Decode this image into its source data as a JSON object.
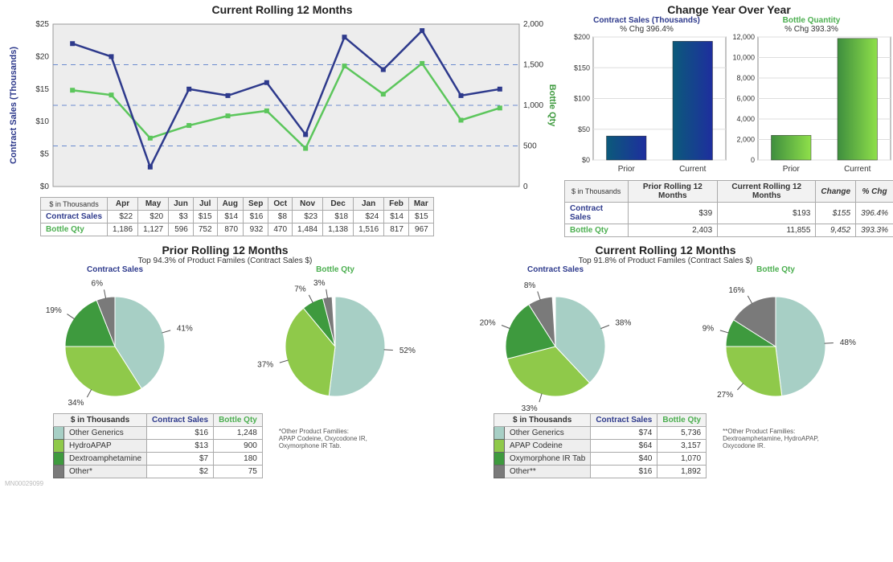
{
  "chart_data": [
    {
      "type": "line",
      "title": "Current Rolling 12 Months",
      "categories": [
        "Apr",
        "May",
        "Jun",
        "Jul",
        "Aug",
        "Sep",
        "Oct",
        "Nov",
        "Dec",
        "Jan",
        "Feb",
        "Mar"
      ],
      "series": [
        {
          "name": "Contract Sales (Thousands)",
          "values": [
            22,
            20,
            3,
            15,
            14,
            16,
            8,
            23,
            18,
            24,
            14,
            15
          ],
          "axis": "left",
          "color": "#2E3A8C"
        },
        {
          "name": "Bottle Qty",
          "values": [
            1186,
            1127,
            596,
            752,
            870,
            932,
            470,
            1484,
            1138,
            1516,
            817,
            967
          ],
          "axis": "right",
          "color": "#5CC65C"
        }
      ],
      "yleft": {
        "label": "Contract Sales (Thousands)",
        "ticks": [
          "$0",
          "$5",
          "$10",
          "$15",
          "$20",
          "$25"
        ],
        "lim": [
          0,
          25
        ]
      },
      "yright": {
        "label": "Bottle Qty",
        "ticks": [
          "0",
          "500",
          "1,000",
          "1,500",
          "2,000"
        ],
        "lim": [
          0,
          2000
        ]
      }
    },
    {
      "type": "bar",
      "title": "Contract Sales (Thousands)",
      "subtitle": "% Chg 396.4%",
      "categories": [
        "Prior",
        "Current"
      ],
      "values": [
        39,
        193
      ],
      "ylim": [
        0,
        200
      ],
      "yticks": [
        "$0",
        "$50",
        "$100",
        "$150",
        "$200"
      ],
      "color_from": "#0B5A7A",
      "color_to": "#1E2E9E"
    },
    {
      "type": "bar",
      "title": "Bottle Quantity",
      "subtitle": "% Chg 393.3%",
      "categories": [
        "Prior",
        "Current"
      ],
      "values": [
        2403,
        11855
      ],
      "ylim": [
        0,
        12000
      ],
      "yticks": [
        "0",
        "2,000",
        "4,000",
        "6,000",
        "8,000",
        "10,000",
        "12,000"
      ],
      "color_from": "#3E8E3E",
      "color_to": "#8FE04A"
    },
    {
      "type": "pie",
      "title": "Prior Rolling 12 Months – Contract Sales",
      "slices": [
        {
          "label": "Other Generics",
          "value": 41,
          "color": "#A7CFC5"
        },
        {
          "label": "HydroAPAP",
          "value": 34,
          "color": "#8FC94A"
        },
        {
          "label": "Dextroamphetamine",
          "value": 19,
          "color": "#3E9A3E"
        },
        {
          "label": "Other*",
          "value": 6,
          "color": "#7A7A7A"
        }
      ]
    },
    {
      "type": "pie",
      "title": "Prior Rolling 12 Months – Bottle Qty",
      "slices": [
        {
          "label": "Other Generics",
          "value": 52,
          "color": "#A7CFC5"
        },
        {
          "label": "HydroAPAP",
          "value": 37,
          "color": "#8FC94A"
        },
        {
          "label": "Dextroamphetamine",
          "value": 7,
          "color": "#3E9A3E"
        },
        {
          "label": "Other*",
          "value": 3,
          "color": "#7A7A7A"
        }
      ]
    },
    {
      "type": "pie",
      "title": "Current Rolling 12 Months – Contract Sales",
      "slices": [
        {
          "label": "Other Generics",
          "value": 38,
          "color": "#A7CFC5"
        },
        {
          "label": "APAP Codeine",
          "value": 33,
          "color": "#8FC94A"
        },
        {
          "label": "Oxymorphone IR Tab",
          "value": 20,
          "color": "#3E9A3E"
        },
        {
          "label": "Other**",
          "value": 8,
          "color": "#7A7A7A"
        }
      ]
    },
    {
      "type": "pie",
      "title": "Current Rolling 12 Months – Bottle Qty",
      "slices": [
        {
          "label": "Other Generics",
          "value": 48,
          "color": "#A7CFC5"
        },
        {
          "label": "APAP Codeine",
          "value": 27,
          "color": "#8FC94A"
        },
        {
          "label": "Oxymorphone IR Tab",
          "value": 9,
          "color": "#3E9A3E"
        },
        {
          "label": "Other**",
          "value": 16,
          "color": "#7A7A7A"
        }
      ]
    }
  ],
  "main": {
    "title": "Current Rolling 12 Months",
    "yleft_label": "Contract Sales (Thousands)",
    "yright_label": "Bottle Qty",
    "yleft_ticks": [
      "$25",
      "$20",
      "$15",
      "$10",
      "$5",
      "$0"
    ],
    "yright_ticks": [
      "2,000",
      "1,500",
      "1,000",
      "500",
      "0"
    ],
    "months": [
      "Apr",
      "May",
      "Jun",
      "Jul",
      "Aug",
      "Sep",
      "Oct",
      "Nov",
      "Dec",
      "Jan",
      "Feb",
      "Mar"
    ],
    "table": {
      "head": "$ in Thousands",
      "rows": [
        {
          "label": "Contract Sales",
          "cls": "navy",
          "cells": [
            "$22",
            "$20",
            "$3",
            "$15",
            "$14",
            "$16",
            "$8",
            "$23",
            "$18",
            "$24",
            "$14",
            "$15"
          ]
        },
        {
          "label": "Bottle Qty",
          "cls": "green",
          "cells": [
            "1,186",
            "1,127",
            "596",
            "752",
            "870",
            "932",
            "470",
            "1,484",
            "1,138",
            "1,516",
            "817",
            "967"
          ]
        }
      ]
    }
  },
  "yoy": {
    "title": "Change Year Over Year",
    "left": {
      "title": "Contract Sales (Thousands)",
      "sub": "% Chg 396.4%",
      "ticks": [
        "$200",
        "$150",
        "$100",
        "$50",
        "$0"
      ],
      "cats": [
        "Prior",
        "Current"
      ],
      "vals": [
        39,
        193
      ],
      "max": 200
    },
    "right": {
      "title": "Bottle Quantity",
      "sub": "% Chg 393.3%",
      "ticks": [
        "12,000",
        "10,000",
        "8,000",
        "6,000",
        "4,000",
        "2,000",
        "0"
      ],
      "cats": [
        "Prior",
        "Current"
      ],
      "vals": [
        2403,
        11855
      ],
      "max": 12000
    },
    "table": {
      "head": [
        "$ in Thousands",
        "Prior Rolling 12 Months",
        "Current Rolling 12 Months",
        "Change",
        "% Chg"
      ],
      "rows": [
        {
          "label": "Contract Sales",
          "cls": "navy",
          "cells": [
            "$39",
            "$193",
            "$155",
            "396.4%"
          ]
        },
        {
          "label": "Bottle Qty",
          "cls": "green",
          "cells": [
            "2,403",
            "11,855",
            "9,452",
            "393.3%"
          ]
        }
      ]
    }
  },
  "prior": {
    "title": "Prior Rolling 12 Months",
    "sub": "Top 94.3% of Product Familes (Contract Sales $)",
    "left_title": "Contract Sales",
    "right_title": "Bottle Qty",
    "products": [
      {
        "name": "Other Generics",
        "color": "#A7CFC5",
        "sales": "$16",
        "qty": "1,248"
      },
      {
        "name": "HydroAPAP",
        "color": "#8FC94A",
        "sales": "$13",
        "qty": "900"
      },
      {
        "name": "Dextroamphetamine",
        "color": "#3E9A3E",
        "sales": "$7",
        "qty": "180"
      },
      {
        "name": "Other*",
        "color": "#7A7A7A",
        "sales": "$2",
        "qty": "75"
      }
    ],
    "table_head": {
      "col0": "$ in Thousands",
      "col1": "Contract Sales",
      "col2": "Bottle Qty"
    },
    "foot": "*Other Product Families:\nAPAP Codeine, Oxycodone IR,\nOxymorphone IR Tab."
  },
  "current": {
    "title": "Current Rolling 12 Months",
    "sub": "Top 91.8% of Product Familes (Contract Sales $)",
    "left_title": "Contract Sales",
    "right_title": "Bottle Qty",
    "products": [
      {
        "name": "Other Generics",
        "color": "#A7CFC5",
        "sales": "$74",
        "qty": "5,736"
      },
      {
        "name": "APAP Codeine",
        "color": "#8FC94A",
        "sales": "$64",
        "qty": "3,157"
      },
      {
        "name": "Oxymorphone IR Tab",
        "color": "#3E9A3E",
        "sales": "$40",
        "qty": "1,070"
      },
      {
        "name": "Other**",
        "color": "#7A7A7A",
        "sales": "$16",
        "qty": "1,892"
      }
    ],
    "table_head": {
      "col0": "$ in Thousands",
      "col1": "Contract Sales",
      "col2": "Bottle Qty"
    },
    "foot": "**Other Product Families:\nDextroamphetamine, HydroAPAP,\nOxycodone IR."
  },
  "id": "MN00029099"
}
